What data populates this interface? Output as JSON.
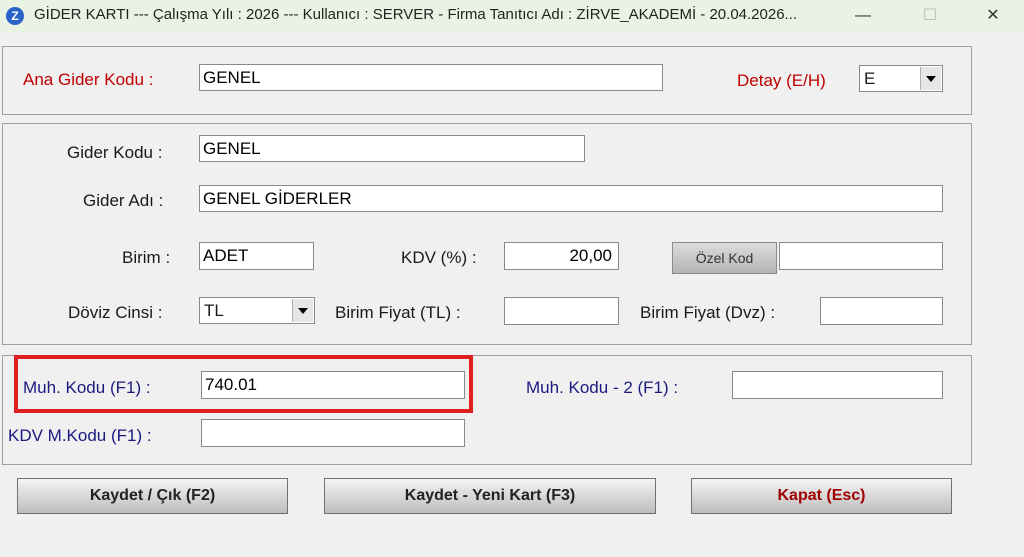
{
  "window": {
    "app_icon_letter": "Z",
    "title": "GİDER KARTI  ---  Çalışma Yılı : 2026  ---  Kullanıcı : SERVER - Firma Tanıtıcı Adı : ZİRVE_AKADEMİ - 20.04.2026...",
    "minimize": "—",
    "maximize": "☐",
    "close": "✕"
  },
  "top_panel": {
    "ana_gider_kodu_label": "Ana Gider Kodu :",
    "ana_gider_kodu_value": "GENEL",
    "detay_label": "Detay (E/H)",
    "detay_value": "E"
  },
  "main_panel": {
    "gider_kodu_label": "Gider Kodu :",
    "gider_kodu_value": "GENEL",
    "gider_adi_label": "Gider Adı :",
    "gider_adi_value": "GENEL GİDERLER",
    "birim_label": "Birim :",
    "birim_value": "ADET",
    "kdv_label": "KDV (%) :",
    "kdv_value": "20,00",
    "ozel_kod_button": "Özel Kod",
    "ozel_kod_value": "",
    "doviz_label": "Döviz Cinsi :",
    "doviz_value": "TL",
    "birim_fiyat_tl_label": "Birim Fiyat (TL) :",
    "birim_fiyat_tl_value": "",
    "birim_fiyat_dvz_label": "Birim Fiyat (Dvz) :",
    "birim_fiyat_dvz_value": ""
  },
  "account_panel": {
    "muh_kodu_label": "Muh. Kodu (F1) :",
    "muh_kodu_value": "740.01",
    "muh_kodu2_label": "Muh. Kodu - 2 (F1) :",
    "muh_kodu2_value": "",
    "kdv_mkodu_label": "KDV M.Kodu (F1) :",
    "kdv_mkodu_value": ""
  },
  "buttons": {
    "save_exit": "Kaydet / Çık (F2)",
    "save_new": "Kaydet - Yeni Kart (F3)",
    "close": "Kapat (Esc)"
  },
  "colors": {
    "label_red": "#c00000",
    "label_navy": "#1a1a80",
    "highlight": "#e02020",
    "titlebar": "#eaf3e3"
  }
}
